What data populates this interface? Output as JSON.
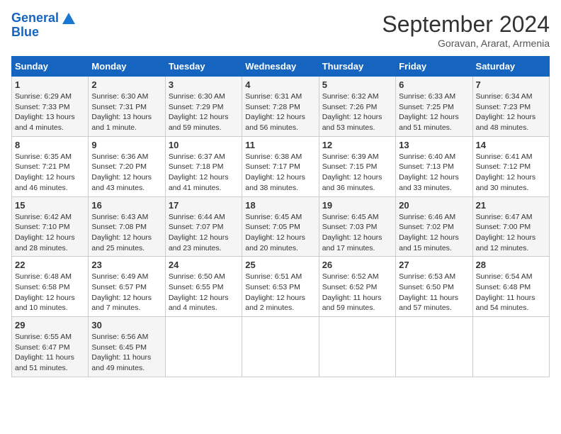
{
  "logo": {
    "line1": "General",
    "line2": "Blue"
  },
  "header": {
    "month": "September 2024",
    "location": "Goravan, Ararat, Armenia"
  },
  "weekdays": [
    "Sunday",
    "Monday",
    "Tuesday",
    "Wednesday",
    "Thursday",
    "Friday",
    "Saturday"
  ],
  "weeks": [
    [
      {
        "day": "1",
        "sunrise": "Sunrise: 6:29 AM",
        "sunset": "Sunset: 7:33 PM",
        "daylight": "Daylight: 13 hours and 4 minutes."
      },
      {
        "day": "2",
        "sunrise": "Sunrise: 6:30 AM",
        "sunset": "Sunset: 7:31 PM",
        "daylight": "Daylight: 13 hours and 1 minute."
      },
      {
        "day": "3",
        "sunrise": "Sunrise: 6:30 AM",
        "sunset": "Sunset: 7:29 PM",
        "daylight": "Daylight: 12 hours and 59 minutes."
      },
      {
        "day": "4",
        "sunrise": "Sunrise: 6:31 AM",
        "sunset": "Sunset: 7:28 PM",
        "daylight": "Daylight: 12 hours and 56 minutes."
      },
      {
        "day": "5",
        "sunrise": "Sunrise: 6:32 AM",
        "sunset": "Sunset: 7:26 PM",
        "daylight": "Daylight: 12 hours and 53 minutes."
      },
      {
        "day": "6",
        "sunrise": "Sunrise: 6:33 AM",
        "sunset": "Sunset: 7:25 PM",
        "daylight": "Daylight: 12 hours and 51 minutes."
      },
      {
        "day": "7",
        "sunrise": "Sunrise: 6:34 AM",
        "sunset": "Sunset: 7:23 PM",
        "daylight": "Daylight: 12 hours and 48 minutes."
      }
    ],
    [
      {
        "day": "8",
        "sunrise": "Sunrise: 6:35 AM",
        "sunset": "Sunset: 7:21 PM",
        "daylight": "Daylight: 12 hours and 46 minutes."
      },
      {
        "day": "9",
        "sunrise": "Sunrise: 6:36 AM",
        "sunset": "Sunset: 7:20 PM",
        "daylight": "Daylight: 12 hours and 43 minutes."
      },
      {
        "day": "10",
        "sunrise": "Sunrise: 6:37 AM",
        "sunset": "Sunset: 7:18 PM",
        "daylight": "Daylight: 12 hours and 41 minutes."
      },
      {
        "day": "11",
        "sunrise": "Sunrise: 6:38 AM",
        "sunset": "Sunset: 7:17 PM",
        "daylight": "Daylight: 12 hours and 38 minutes."
      },
      {
        "day": "12",
        "sunrise": "Sunrise: 6:39 AM",
        "sunset": "Sunset: 7:15 PM",
        "daylight": "Daylight: 12 hours and 36 minutes."
      },
      {
        "day": "13",
        "sunrise": "Sunrise: 6:40 AM",
        "sunset": "Sunset: 7:13 PM",
        "daylight": "Daylight: 12 hours and 33 minutes."
      },
      {
        "day": "14",
        "sunrise": "Sunrise: 6:41 AM",
        "sunset": "Sunset: 7:12 PM",
        "daylight": "Daylight: 12 hours and 30 minutes."
      }
    ],
    [
      {
        "day": "15",
        "sunrise": "Sunrise: 6:42 AM",
        "sunset": "Sunset: 7:10 PM",
        "daylight": "Daylight: 12 hours and 28 minutes."
      },
      {
        "day": "16",
        "sunrise": "Sunrise: 6:43 AM",
        "sunset": "Sunset: 7:08 PM",
        "daylight": "Daylight: 12 hours and 25 minutes."
      },
      {
        "day": "17",
        "sunrise": "Sunrise: 6:44 AM",
        "sunset": "Sunset: 7:07 PM",
        "daylight": "Daylight: 12 hours and 23 minutes."
      },
      {
        "day": "18",
        "sunrise": "Sunrise: 6:45 AM",
        "sunset": "Sunset: 7:05 PM",
        "daylight": "Daylight: 12 hours and 20 minutes."
      },
      {
        "day": "19",
        "sunrise": "Sunrise: 6:45 AM",
        "sunset": "Sunset: 7:03 PM",
        "daylight": "Daylight: 12 hours and 17 minutes."
      },
      {
        "day": "20",
        "sunrise": "Sunrise: 6:46 AM",
        "sunset": "Sunset: 7:02 PM",
        "daylight": "Daylight: 12 hours and 15 minutes."
      },
      {
        "day": "21",
        "sunrise": "Sunrise: 6:47 AM",
        "sunset": "Sunset: 7:00 PM",
        "daylight": "Daylight: 12 hours and 12 minutes."
      }
    ],
    [
      {
        "day": "22",
        "sunrise": "Sunrise: 6:48 AM",
        "sunset": "Sunset: 6:58 PM",
        "daylight": "Daylight: 12 hours and 10 minutes."
      },
      {
        "day": "23",
        "sunrise": "Sunrise: 6:49 AM",
        "sunset": "Sunset: 6:57 PM",
        "daylight": "Daylight: 12 hours and 7 minutes."
      },
      {
        "day": "24",
        "sunrise": "Sunrise: 6:50 AM",
        "sunset": "Sunset: 6:55 PM",
        "daylight": "Daylight: 12 hours and 4 minutes."
      },
      {
        "day": "25",
        "sunrise": "Sunrise: 6:51 AM",
        "sunset": "Sunset: 6:53 PM",
        "daylight": "Daylight: 12 hours and 2 minutes."
      },
      {
        "day": "26",
        "sunrise": "Sunrise: 6:52 AM",
        "sunset": "Sunset: 6:52 PM",
        "daylight": "Daylight: 11 hours and 59 minutes."
      },
      {
        "day": "27",
        "sunrise": "Sunrise: 6:53 AM",
        "sunset": "Sunset: 6:50 PM",
        "daylight": "Daylight: 11 hours and 57 minutes."
      },
      {
        "day": "28",
        "sunrise": "Sunrise: 6:54 AM",
        "sunset": "Sunset: 6:48 PM",
        "daylight": "Daylight: 11 hours and 54 minutes."
      }
    ],
    [
      {
        "day": "29",
        "sunrise": "Sunrise: 6:55 AM",
        "sunset": "Sunset: 6:47 PM",
        "daylight": "Daylight: 11 hours and 51 minutes."
      },
      {
        "day": "30",
        "sunrise": "Sunrise: 6:56 AM",
        "sunset": "Sunset: 6:45 PM",
        "daylight": "Daylight: 11 hours and 49 minutes."
      },
      null,
      null,
      null,
      null,
      null
    ]
  ]
}
